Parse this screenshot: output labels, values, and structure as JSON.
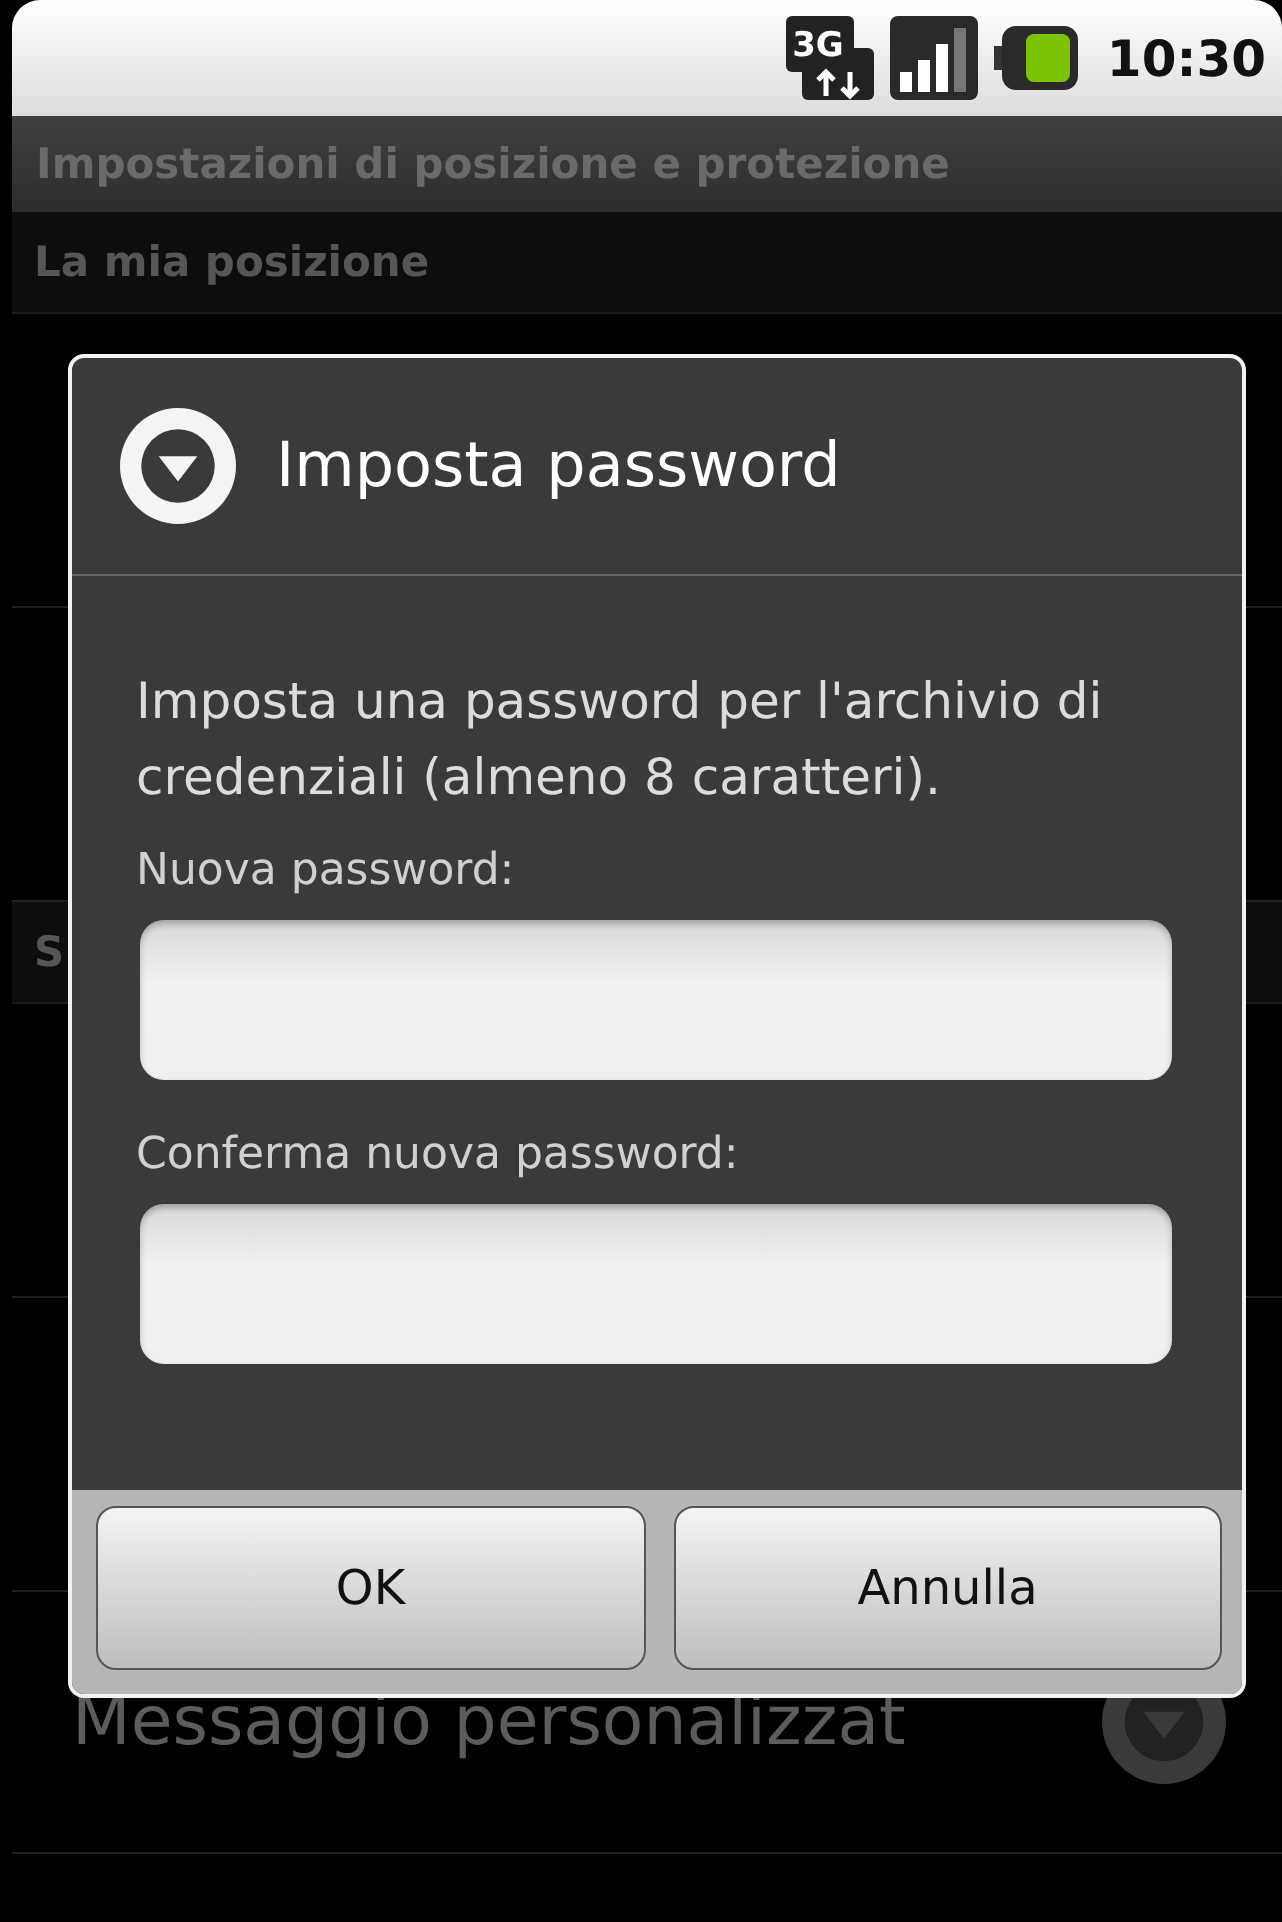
{
  "status_bar": {
    "network": "3G",
    "time": "10:30"
  },
  "title_bar": {
    "title": "Impostazioni di posizione e protezione"
  },
  "background": [
    {
      "kind": "header",
      "text": "La mia posizione"
    },
    {
      "kind": "blank"
    },
    {
      "kind": "blank"
    },
    {
      "kind": "header",
      "text": "S"
    },
    {
      "kind": "blank"
    },
    {
      "kind": "blank"
    },
    {
      "kind": "item",
      "text": "Messaggio personalizzat"
    }
  ],
  "dialog": {
    "title": "Imposta password",
    "message": "Imposta una password per l'archivio di credenziali (almeno 8 caratteri).",
    "fields": [
      {
        "label": "Nuova password:"
      },
      {
        "label": "Conferma nuova password:"
      }
    ],
    "buttons": [
      "OK",
      "Annulla"
    ]
  }
}
